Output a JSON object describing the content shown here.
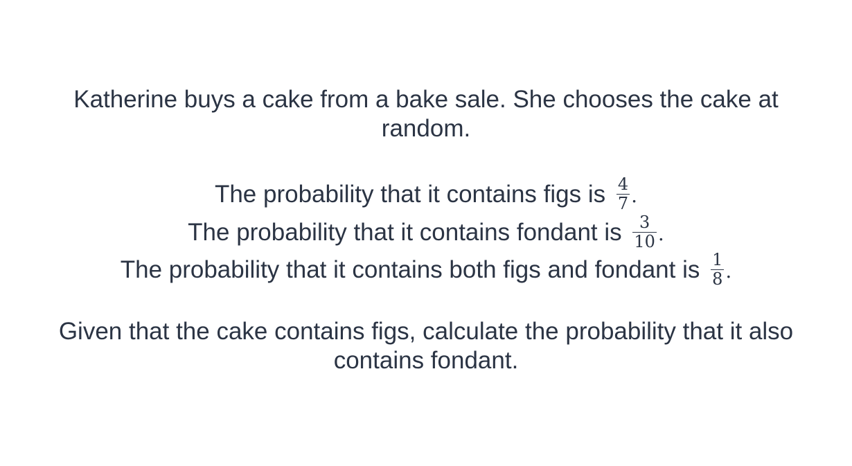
{
  "question": {
    "intro_line1": "Katherine buys a cake from a bake sale. She chooses the cake at",
    "intro_line2": "random.",
    "statements": [
      {
        "text": "The probability that it contains figs is ",
        "numerator": "4",
        "denominator": "7",
        "end": "."
      },
      {
        "text": "The probability that it contains fondant is ",
        "numerator": "3",
        "denominator": "10",
        "end": "."
      },
      {
        "text": "The probability that it contains both figs and fondant is ",
        "numerator": "1",
        "denominator": "8",
        "end": "."
      }
    ],
    "ask_line1": "Given that the cake contains figs, calculate the probability that it also",
    "ask_line2": "contains fondant."
  }
}
